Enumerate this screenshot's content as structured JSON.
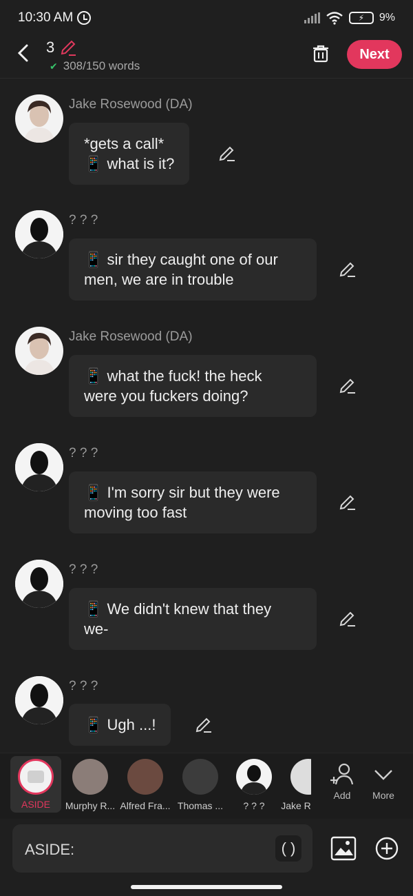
{
  "status_bar": {
    "time": "10:30 AM",
    "battery": "9%"
  },
  "header": {
    "count": "3",
    "words": "308/150 words",
    "next_label": "Next"
  },
  "messages": [
    {
      "name": "Jake Rosewood (DA)",
      "line1": "*gets a call*",
      "line2": "📱 what is it?"
    },
    {
      "name": "? ? ?",
      "line1": "📱 sir they caught one of our",
      "line2": "men, we are in trouble"
    },
    {
      "name": "Jake Rosewood (DA)",
      "line1": "📱 what the fuck! the heck",
      "line2": "were you fuckers doing?"
    },
    {
      "name": "? ? ?",
      "line1": "📱 I'm sorry sir but they were",
      "line2": "moving too fast"
    },
    {
      "name": "? ? ?",
      "line1": "📱 We didn't knew that they",
      "line2": "we-"
    },
    {
      "name": "? ? ?",
      "line1": "📱 Ugh ...!"
    }
  ],
  "characters": [
    {
      "label": "ASIDE",
      "selected": true
    },
    {
      "label": "Murphy R..."
    },
    {
      "label": "Alfred Fra..."
    },
    {
      "label": "Thomas ..."
    },
    {
      "label": "? ? ?"
    },
    {
      "label": "Jake R"
    }
  ],
  "tools": {
    "add": "Add",
    "more": "More"
  },
  "input": {
    "placeholder": "ASIDE:",
    "paren": "( )"
  },
  "colors": {
    "accent": "#e2375d",
    "underline": "#f07a1a",
    "bubble": "#2a2a2a",
    "background": "#1f1f1f"
  }
}
